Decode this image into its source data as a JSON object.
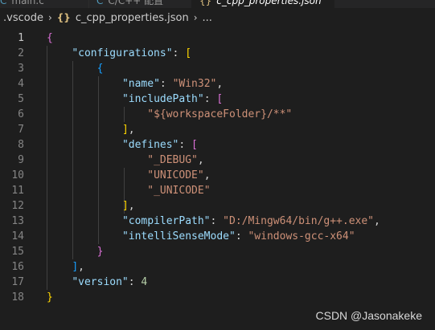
{
  "tabs": [
    {
      "icon": "C",
      "label": "main.c"
    },
    {
      "icon": "C",
      "label": "C/C++ 配置"
    },
    {
      "icon": "{}",
      "label": "c_cpp_properties.json",
      "close": "×"
    }
  ],
  "breadcrumb": {
    "folder": ".vscode",
    "braces": "{}",
    "file": "c_cpp_properties.json",
    "more": "..."
  },
  "editor": {
    "current_line": 1,
    "lines": [
      {
        "n": "1",
        "text": "{"
      },
      {
        "n": "2",
        "text": "    \"configurations\": ["
      },
      {
        "n": "3",
        "text": "        {"
      },
      {
        "n": "4",
        "text": "            \"name\": \"Win32\","
      },
      {
        "n": "5",
        "text": "            \"includePath\": ["
      },
      {
        "n": "6",
        "text": "                \"${workspaceFolder}/**\""
      },
      {
        "n": "7",
        "text": "            ],"
      },
      {
        "n": "8",
        "text": "            \"defines\": ["
      },
      {
        "n": "9",
        "text": "                \"_DEBUG\","
      },
      {
        "n": "10",
        "text": "                \"UNICODE\","
      },
      {
        "n": "11",
        "text": "                \"_UNICODE\""
      },
      {
        "n": "12",
        "text": "            ],"
      },
      {
        "n": "13",
        "text": "            \"compilerPath\": \"D:/Mingw64/bin/g++.exe\","
      },
      {
        "n": "14",
        "text": "            \"intelliSenseMode\": \"windows-gcc-x64\""
      },
      {
        "n": "15",
        "text": "        }"
      },
      {
        "n": "16",
        "text": "    ],"
      },
      {
        "n": "17",
        "text": "    \"version\": 4"
      },
      {
        "n": "18",
        "text": "}"
      }
    ]
  },
  "watermark": "CSDN @Jasonakeke",
  "colors": {
    "background": "#1e1e1e",
    "key": "#9cdcfe",
    "string": "#ce9178",
    "number": "#b5cea8",
    "bracket_level1": "#ffd700",
    "bracket_level2": "#da70d6",
    "bracket_level3": "#179fff"
  }
}
